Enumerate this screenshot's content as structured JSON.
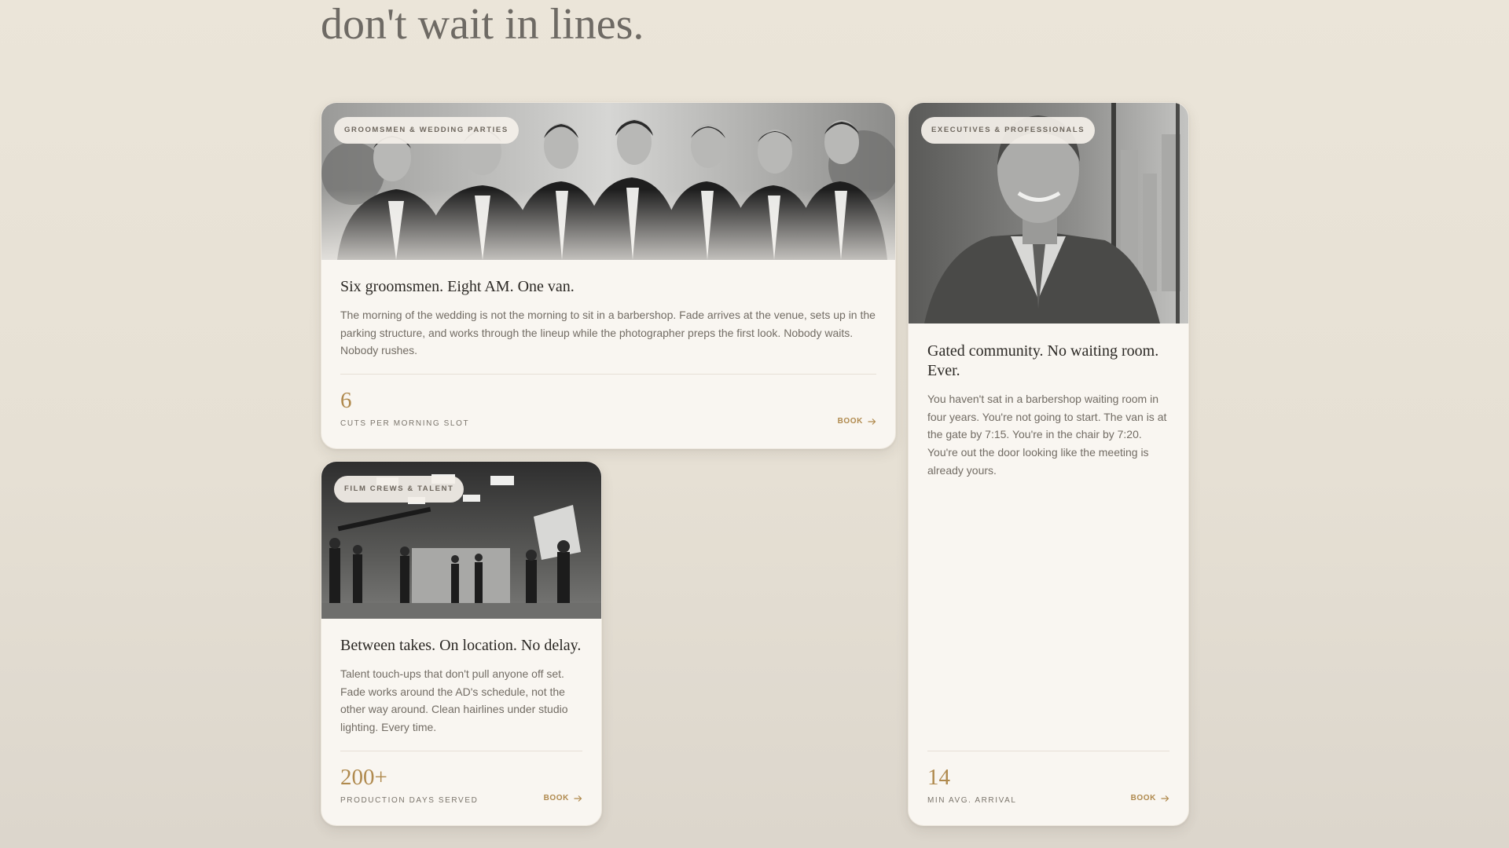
{
  "headline": "don't wait in lines.",
  "accent_color": "#b08a4e",
  "cards": [
    {
      "badge": "GROOMSMEN & WEDDING PARTIES",
      "image": "groomsmen-group-photo",
      "title": "Six groomsmen. Eight AM. One van.",
      "description": "The morning of the wedding is not the morning to sit in a barbershop. Fade arrives at the venue, sets up in the parking structure, and works through the lineup while the photographer preps the first look. Nobody waits. Nobody rushes.",
      "stat_value": "6",
      "stat_label": "CUTS PER MORNING SLOT",
      "book_label": "BOOK",
      "book_icon": "arrow-right-icon"
    },
    {
      "badge": "EXECUTIVES & PROFESSIONALS",
      "image": "executive-portrait-photo",
      "title": "Gated community. No waiting room. Ever.",
      "description": "You haven't sat in a barbershop waiting room in four years. You're not going to start. The van is at the gate by 7:15. You're in the chair by 7:20. You're out the door looking like the meeting is already yours.",
      "stat_value": "14",
      "stat_label": "MIN AVG. ARRIVAL",
      "book_label": "BOOK",
      "book_icon": "arrow-right-icon"
    },
    {
      "badge": "FILM CREWS & TALENT",
      "image": "film-set-photo",
      "title": "Between takes. On location. No delay.",
      "description": "Talent touch-ups that don't pull anyone off set. Fade works around the AD's schedule, not the other way around. Clean hairlines under studio lighting. Every time.",
      "stat_value": "200+",
      "stat_label": "PRODUCTION DAYS SERVED",
      "book_label": "BOOK",
      "book_icon": "arrow-right-icon"
    }
  ]
}
